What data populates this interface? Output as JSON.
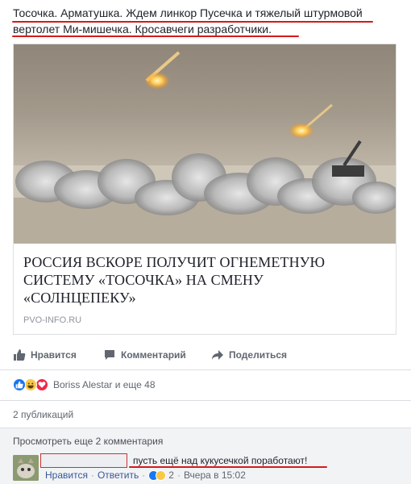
{
  "post": {
    "text": "Тосочка. Арматушка. Ждем линкор Пусечка и тяжелый штурмовой вертолет Ми-мишечка. Кросавчеги разработчики."
  },
  "link_preview": {
    "title": "РОССИЯ ВСКОРЕ ПОЛУЧИТ ОГНЕМЕТНУЮ СИСТЕМУ «ТОСОЧКА» НА СМЕНУ «СОЛНЦЕПЕКУ»",
    "domain": "PVO-INFO.RU"
  },
  "actions": {
    "like": "Нравится",
    "comment": "Комментарий",
    "share": "Поделиться"
  },
  "reactions": {
    "summary": "Boriss Alestar и еще 48",
    "icons": [
      "like-icon",
      "haha-icon",
      "love-icon"
    ]
  },
  "shares": {
    "label": "2 публикаций"
  },
  "comments": {
    "view_more": "Просмотреть еще 2 комментария",
    "items": [
      {
        "author_hidden": "",
        "text": "пусть ещё над кукусечкой поработают!",
        "like": "Нравится",
        "reply": "Ответить",
        "reaction_count": "2",
        "time": "Вчера в 15:02"
      }
    ]
  },
  "colors": {
    "link": "#385898",
    "muted": "#606770",
    "like_blue": "#1877f2",
    "love_red": "#f0284a",
    "haha_yellow": "#f7c948",
    "annotation_red": "#d41a1a"
  }
}
